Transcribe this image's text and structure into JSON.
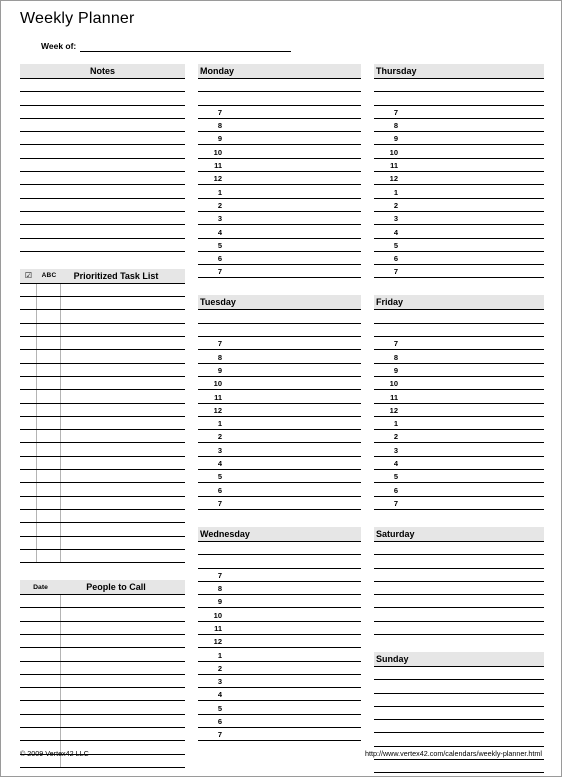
{
  "document": {
    "title": "Weekly Planner",
    "week_of_label": "Week of:",
    "week_of_value": ""
  },
  "colors": {
    "header_band": "#e6e6e6",
    "rule": "#000000",
    "divider": "#b4b4b4",
    "page_border": "#9a9a9a",
    "background": "#ffffff"
  },
  "notes": {
    "header": "Notes",
    "line_count": 13
  },
  "task_list": {
    "header": "Prioritized Task List",
    "checkbox_glyph": "☑",
    "priority_header": "ABC",
    "row_count": 21
  },
  "people_to_call": {
    "header": "People to Call",
    "date_header": "Date",
    "row_count": 13
  },
  "hours": [
    "7",
    "8",
    "9",
    "10",
    "11",
    "12",
    "1",
    "2",
    "3",
    "4",
    "5",
    "6",
    "7"
  ],
  "days": [
    {
      "name": "Monday",
      "column": "mid",
      "blank_lines": 2,
      "has_hours": true,
      "trailing_blank": 0
    },
    {
      "name": "Tuesday",
      "column": "mid",
      "blank_lines": 2,
      "has_hours": true,
      "trailing_blank": 0
    },
    {
      "name": "Wednesday",
      "column": "mid",
      "blank_lines": 2,
      "has_hours": true,
      "trailing_blank": 0
    },
    {
      "name": "Thursday",
      "column": "right",
      "blank_lines": 2,
      "has_hours": true,
      "trailing_blank": 0
    },
    {
      "name": "Friday",
      "column": "right",
      "blank_lines": 2,
      "has_hours": true,
      "trailing_blank": 0
    },
    {
      "name": "Saturday",
      "column": "right",
      "blank_lines": 7,
      "has_hours": false,
      "trailing_blank": 0
    },
    {
      "name": "Sunday",
      "column": "right",
      "blank_lines": 8,
      "has_hours": false,
      "trailing_blank": 0
    }
  ],
  "footer": {
    "copyright": "© 2009 Vertex42 LLC",
    "url": "http://www.vertex42.com/calendars/weekly-planner.html"
  }
}
